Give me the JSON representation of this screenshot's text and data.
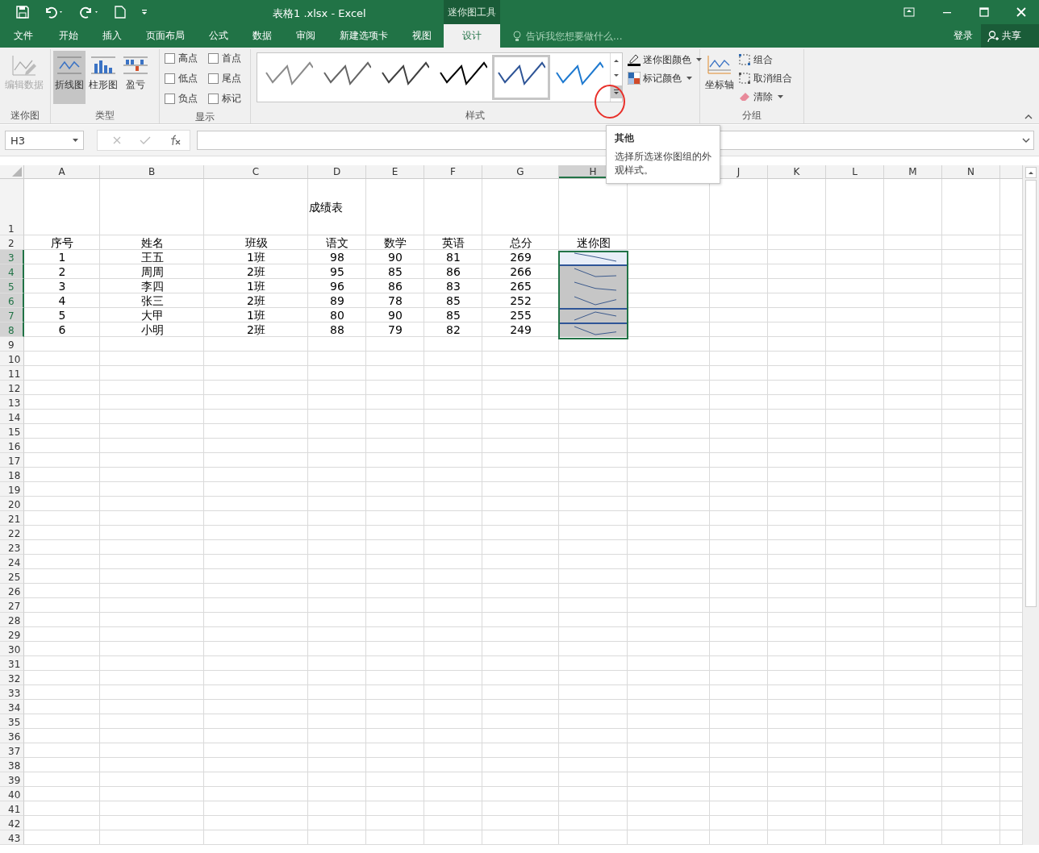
{
  "window": {
    "title": "表格1 .xlsx - Excel",
    "context_label": "迷你图工具"
  },
  "tabs": [
    {
      "label": "文件",
      "selected": false
    },
    {
      "label": "开始",
      "selected": false
    },
    {
      "label": "插入",
      "selected": false
    },
    {
      "label": "页面布局",
      "selected": false
    },
    {
      "label": "公式",
      "selected": false
    },
    {
      "label": "数据",
      "selected": false
    },
    {
      "label": "审阅",
      "selected": false
    },
    {
      "label": "新建选项卡",
      "selected": false
    },
    {
      "label": "视图",
      "selected": false
    },
    {
      "label": "设计",
      "selected": true
    }
  ],
  "tell_me": {
    "placeholder": "告诉我您想要做什么..."
  },
  "account": {
    "login": "登录",
    "share": "共享"
  },
  "ribbon": {
    "sparkline_group": {
      "label": "迷你图",
      "edit": {
        "label": "编辑数据",
        "disabled": true
      }
    },
    "type_group": {
      "label": "类型",
      "items": [
        {
          "label": "折线图",
          "kind": "line",
          "selected": true
        },
        {
          "label": "柱形图",
          "kind": "column",
          "selected": false
        },
        {
          "label": "盈亏",
          "kind": "winloss",
          "selected": false
        }
      ]
    },
    "show_group": {
      "label": "显示",
      "items": [
        {
          "label": "高点",
          "checked": false
        },
        {
          "label": "首点",
          "checked": false
        },
        {
          "label": "低点",
          "checked": false
        },
        {
          "label": "尾点",
          "checked": false
        },
        {
          "label": "负点",
          "checked": false
        },
        {
          "label": "标记",
          "checked": false
        }
      ]
    },
    "style_group": {
      "label": "样式",
      "styles": [
        {
          "color": "#8c8c8c",
          "selected": false
        },
        {
          "color": "#666666",
          "selected": false
        },
        {
          "color": "#404040",
          "selected": false
        },
        {
          "color": "#000000",
          "selected": false
        },
        {
          "color": "#2f5597",
          "selected": true
        },
        {
          "color": "#1f7ad0",
          "selected": false
        }
      ],
      "sparkline_color": "迷你图颜色",
      "marker_color": "标记颜色"
    },
    "group_group": {
      "label": "分组",
      "axis": "坐标轴",
      "group": "组合",
      "ungroup": "取消组合",
      "clear": "清除"
    }
  },
  "tooltip": {
    "title": "其他",
    "text": "选择所选迷你图组的外观样式。"
  },
  "formula_bar": {
    "name_box": "H3"
  },
  "sheet": {
    "columns": [
      {
        "label": "A"
      },
      {
        "label": "B"
      },
      {
        "label": "C"
      },
      {
        "label": "D"
      },
      {
        "label": "E"
      },
      {
        "label": "F"
      },
      {
        "label": "G"
      },
      {
        "label": "H",
        "selected": true
      },
      {},
      {
        "label": "J"
      },
      {
        "label": "K"
      },
      {
        "label": "L"
      },
      {
        "label": "M"
      },
      {
        "label": "N"
      },
      {}
    ],
    "rows": [
      {
        "number": "1",
        "title": "成绩表"
      },
      {
        "number": "2",
        "cells": [
          "序号",
          "姓名",
          "班级",
          "语文",
          "数学",
          "英语",
          "总分",
          "迷你图"
        ]
      },
      {
        "number": "3",
        "selected": true,
        "active": true,
        "group_border": false,
        "cells": [
          "1",
          "王五",
          "1班",
          "98",
          "90",
          "81",
          "269"
        ]
      },
      {
        "number": "4",
        "selected": true,
        "active": false,
        "group_border": true,
        "cells": [
          "2",
          "周周",
          "2班",
          "95",
          "85",
          "86",
          "266"
        ]
      },
      {
        "number": "5",
        "selected": true,
        "active": false,
        "group_border": false,
        "cells": [
          "3",
          "李四",
          "1班",
          "96",
          "86",
          "83",
          "265"
        ]
      },
      {
        "number": "6",
        "selected": true,
        "active": false,
        "group_border": false,
        "cells": [
          "4",
          "张三",
          "2班",
          "89",
          "78",
          "85",
          "252"
        ]
      },
      {
        "number": "7",
        "selected": true,
        "active": false,
        "group_border": true,
        "cells": [
          "5",
          "大甲",
          "1班",
          "80",
          "90",
          "85",
          "255"
        ]
      },
      {
        "number": "8",
        "selected": true,
        "active": false,
        "group_border": true,
        "cells": [
          "6",
          "小明",
          "2班",
          "88",
          "79",
          "82",
          "249"
        ]
      },
      {
        "number": "9"
      },
      {
        "number": "10"
      },
      {
        "number": "11"
      },
      {
        "number": "12"
      },
      {
        "number": "13"
      },
      {
        "number": "14"
      },
      {
        "number": "15"
      },
      {
        "number": "16"
      },
      {
        "number": "17"
      },
      {
        "number": "18"
      },
      {
        "number": "19"
      },
      {
        "number": "20"
      },
      {
        "number": "21"
      },
      {
        "number": "22"
      },
      {
        "number": "23"
      },
      {
        "number": "24"
      },
      {
        "number": "25"
      },
      {
        "number": "26"
      },
      {
        "number": "27"
      },
      {
        "number": "28"
      },
      {
        "number": "29"
      },
      {
        "number": "30"
      },
      {
        "number": "31"
      },
      {
        "number": "32"
      },
      {
        "number": "33"
      },
      {
        "number": "34"
      },
      {
        "number": "35"
      },
      {
        "number": "36"
      },
      {
        "number": "37"
      },
      {
        "number": "38"
      },
      {
        "number": "39"
      },
      {
        "number": "40"
      },
      {
        "number": "41"
      },
      {
        "number": "42"
      },
      {
        "number": "43"
      }
    ]
  }
}
